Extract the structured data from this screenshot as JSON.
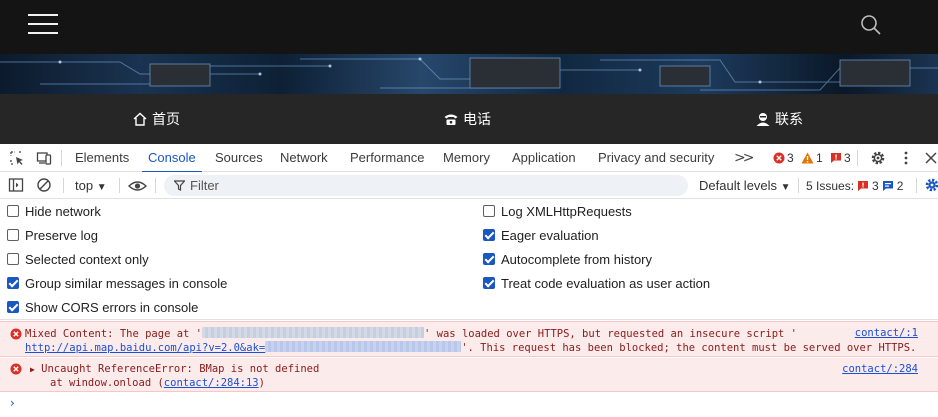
{
  "site": {
    "nav": [
      {
        "label": "首页",
        "icon": "home-icon"
      },
      {
        "label": "电话",
        "icon": "phone-icon"
      },
      {
        "label": "联系",
        "icon": "contact-icon"
      }
    ]
  },
  "devtools": {
    "tabs": [
      "Elements",
      "Console",
      "Sources",
      "Network",
      "Performance",
      "Memory",
      "Application",
      "Privacy and security"
    ],
    "active_tab": "Console",
    "counts": {
      "errors": "3",
      "warnings": "1",
      "info": "3"
    },
    "toolbar": {
      "context": "top",
      "filter_placeholder": "Filter",
      "levels": "Default levels",
      "issues_label": "5 Issues:",
      "issues_errors": "3",
      "issues_info": "2"
    },
    "settings": {
      "left": [
        {
          "label": "Hide network",
          "checked": false
        },
        {
          "label": "Preserve log",
          "checked": false
        },
        {
          "label": "Selected context only",
          "checked": false
        },
        {
          "label": "Group similar messages in console",
          "checked": true
        },
        {
          "label": "Show CORS errors in console",
          "checked": true
        }
      ],
      "right": [
        {
          "label": "Log XMLHttpRequests",
          "checked": false
        },
        {
          "label": "Eager evaluation",
          "checked": true
        },
        {
          "label": "Autocomplete from history",
          "checked": true
        },
        {
          "label": "Treat code evaluation as user action",
          "checked": true
        }
      ]
    },
    "messages": [
      {
        "type": "error",
        "part1": "Mixed Content: The page at '",
        "part2": "' was loaded over HTTPS, but requested an insecure script '",
        "link": "http://api.map.baidu.com/api?v=2.0&ak=",
        "part3": "'. This request has been blocked; the content must be served over HTTPS.",
        "source": "contact/:1"
      },
      {
        "type": "error",
        "text": "Uncaught ReferenceError: BMap is not defined",
        "stack_prefix": "at window.onload (",
        "stack_link": "contact/:284:13",
        "stack_suffix": ")",
        "source": "contact/:284"
      }
    ]
  },
  "colors": {
    "accent": "#1a57c2",
    "error": "#d93025",
    "warning": "#e37400",
    "error_bg": "#fcebeb"
  }
}
